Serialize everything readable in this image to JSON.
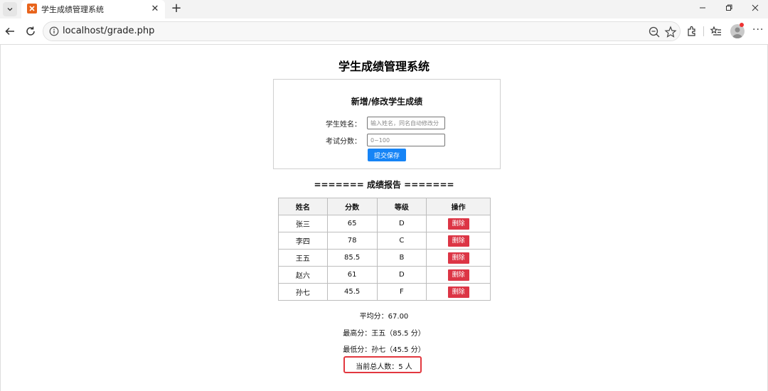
{
  "browser": {
    "tab": {
      "title": "学生成绩管理系统",
      "close_label": "✕"
    },
    "new_tab_label": "+",
    "address": {
      "url": "localhost/grade.php"
    },
    "more_label": "···"
  },
  "colors": {
    "accent_blue": "#1684f6",
    "delete_red": "#dc3545",
    "highlight_red": "#e2383f",
    "favicon_orange": "#e8641c"
  },
  "page": {
    "title": "学生成绩管理系统",
    "form": {
      "title": "新增/修改学生成绩",
      "name_label": "学生姓名：",
      "name_placeholder": "输入姓名，同名自动修改分",
      "score_label": "考试分数：",
      "score_placeholder": "0~100",
      "submit_label": "提交保存"
    },
    "report_title": "======= 成绩报告 =======",
    "table": {
      "headers": [
        "姓名",
        "分数",
        "等级",
        "操作"
      ],
      "delete_label": "删除",
      "rows": [
        {
          "name": "张三",
          "score": "65",
          "grade": "D"
        },
        {
          "name": "李四",
          "score": "78",
          "grade": "C"
        },
        {
          "name": "王五",
          "score": "85.5",
          "grade": "B"
        },
        {
          "name": "赵六",
          "score": "61",
          "grade": "D"
        },
        {
          "name": "孙七",
          "score": "45.5",
          "grade": "F"
        }
      ]
    },
    "stats": {
      "average": "平均分：67.00",
      "highest": "最高分：王五（85.5 分）",
      "lowest": "最低分：孙七（45.5 分）",
      "total": "当前总人数：5 人"
    }
  }
}
